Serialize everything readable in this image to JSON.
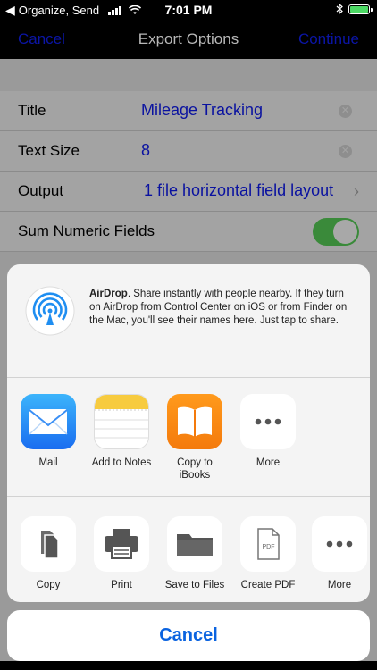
{
  "status_bar": {
    "back_app": "Organize, Send",
    "time": "7:01 PM"
  },
  "nav": {
    "left": "Cancel",
    "title": "Export Options",
    "right": "Continue"
  },
  "form": {
    "rows": [
      {
        "label": "Title",
        "value": "Mileage Tracking"
      },
      {
        "label": "Text Size",
        "value": "8"
      },
      {
        "label": "Output",
        "value": "1 file horizontal field layout"
      },
      {
        "label": "Sum Numeric Fields"
      }
    ],
    "sum_numeric_enabled": true
  },
  "share_sheet": {
    "airdrop": {
      "title": "AirDrop",
      "description": ". Share instantly with people nearby. If they turn on AirDrop from Control Center on iOS or from Finder on the Mac, you'll see their names here. Just tap to share."
    },
    "apps": [
      {
        "label": "Mail",
        "icon": "mail-icon"
      },
      {
        "label": "Add to Notes",
        "icon": "notes-icon"
      },
      {
        "label": "Copy to iBooks",
        "icon": "ibooks-icon"
      },
      {
        "label": "More",
        "icon": "more-icon"
      }
    ],
    "actions": [
      {
        "label": "Copy",
        "icon": "copy-icon"
      },
      {
        "label": "Print",
        "icon": "print-icon"
      },
      {
        "label": "Save to Files",
        "icon": "folder-icon"
      },
      {
        "label": "Create PDF",
        "icon": "pdf-icon"
      },
      {
        "label": "More",
        "icon": "more-icon"
      }
    ],
    "pdf_badge": "PDF"
  },
  "cancel_label": "Cancel",
  "colors": {
    "tint": "#0a63e0",
    "toggle_on": "#3a8a3a"
  }
}
